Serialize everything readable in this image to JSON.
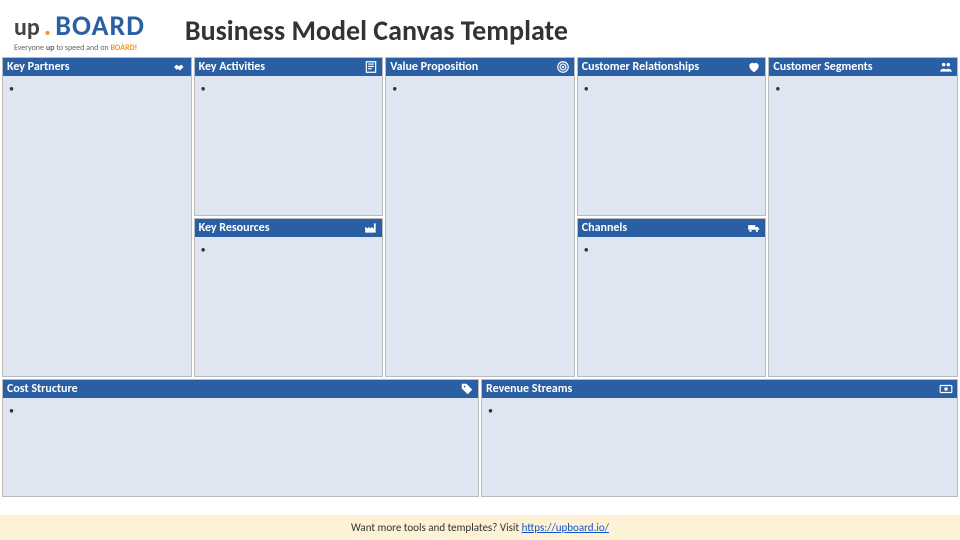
{
  "header": {
    "logo_up": "up",
    "logo_dot": ".",
    "logo_board": "BOARD",
    "tagline_prefix": "Everyone ",
    "tagline_bold1": "up",
    "tagline_mid": " to speed and on ",
    "tagline_bold2": "BOARD",
    "tagline_suffix": "!",
    "title": "Business Model Canvas Template"
  },
  "cells": {
    "key_partners": {
      "title": "Key Partners",
      "bullet": "•"
    },
    "key_activities": {
      "title": "Key Activities",
      "bullet": "•"
    },
    "key_resources": {
      "title": "Key Resources",
      "bullet": "•"
    },
    "value_proposition": {
      "title": "Value Proposition",
      "bullet": "•"
    },
    "customer_relationships": {
      "title": "Customer Relationships",
      "bullet": "•"
    },
    "channels": {
      "title": "Channels",
      "bullet": "•"
    },
    "customer_segments": {
      "title": "Customer Segments",
      "bullet": "•"
    },
    "cost_structure": {
      "title": "Cost Structure",
      "bullet": "•"
    },
    "revenue_streams": {
      "title": "Revenue Streams",
      "bullet": "•"
    }
  },
  "footer": {
    "text": "Want more tools and templates? Visit ",
    "link_text": "https://upboard.io/"
  }
}
